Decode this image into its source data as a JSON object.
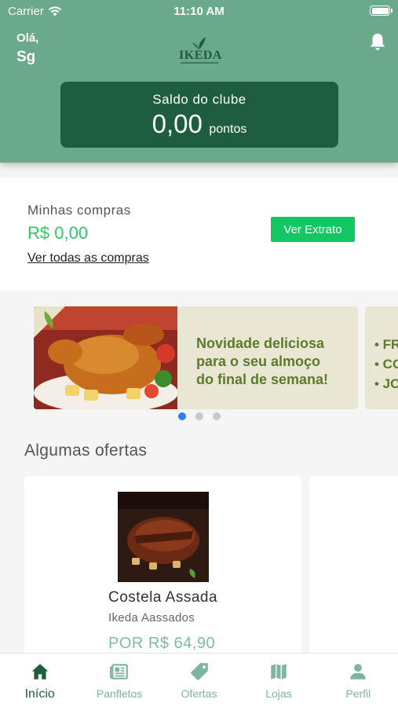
{
  "status_bar": {
    "carrier": "Carrier",
    "time": "11:10 AM"
  },
  "header": {
    "greeting": "Olá,",
    "user_name": "Sg",
    "logo_text": "IKEDA",
    "balance_label": "Saldo do clube",
    "balance_value": "0,00",
    "balance_unit": "pontos"
  },
  "purchases": {
    "title": "Minhas compras",
    "value": "R$ 0,00",
    "all_link": "Ver todas as compras",
    "statement_button": "Ver Extrato"
  },
  "banner": {
    "headline_lines": [
      "Novidade deliciosa",
      "para o seu almoço",
      "do final de semana!"
    ],
    "next_items": [
      "• FR",
      "• CO",
      "• JO"
    ],
    "slide_count": 3,
    "active_slide": 1
  },
  "offers": {
    "title": "Algumas ofertas",
    "items": [
      {
        "name": "Costela Assada",
        "vendor": "Ikeda Aassados",
        "price": "POR R$ 64,90"
      }
    ]
  },
  "tabbar": {
    "tabs": [
      {
        "label": "Início",
        "icon": "home-icon",
        "active": true
      },
      {
        "label": "Panfletos",
        "icon": "newspaper-icon",
        "active": false
      },
      {
        "label": "Ofertas",
        "icon": "tag-icon",
        "active": false
      },
      {
        "label": "Lojas",
        "icon": "map-icon",
        "active": false
      },
      {
        "label": "Perfil",
        "icon": "person-icon",
        "active": false
      }
    ]
  },
  "colors": {
    "header_bg": "#6aa98a",
    "brand_dark": "#1e5e3f",
    "accent_green": "#14c765",
    "price_green": "#7dbda0",
    "dot_active": "#2f7cf6"
  }
}
